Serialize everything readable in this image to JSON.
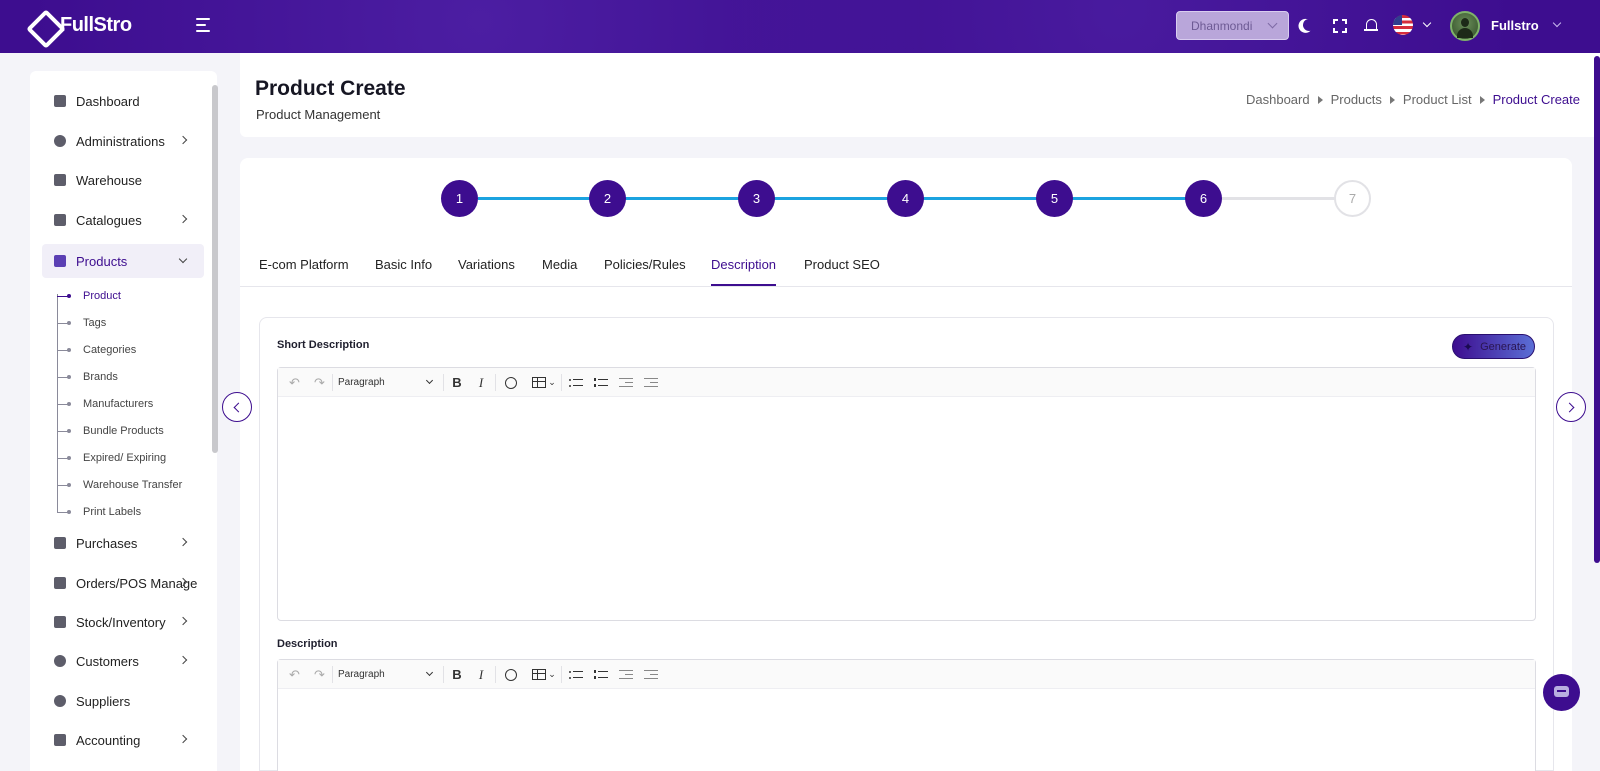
{
  "header": {
    "logo_text": "FullStro",
    "branch": "Dhanmondi",
    "username": "Fullstro"
  },
  "sidebar": {
    "items": [
      {
        "label": "Dashboard"
      },
      {
        "label": "Administrations"
      },
      {
        "label": "Warehouse"
      },
      {
        "label": "Catalogues"
      },
      {
        "label": "Products"
      },
      {
        "label": "Purchases"
      },
      {
        "label": "Orders/POS Manage"
      },
      {
        "label": "Stock/Inventory"
      },
      {
        "label": "Customers"
      },
      {
        "label": "Suppliers"
      },
      {
        "label": "Accounting"
      }
    ],
    "product_sub": [
      "Product",
      "Tags",
      "Categories",
      "Brands",
      "Manufacturers",
      "Bundle Products",
      "Expired/ Expiring",
      "Warehouse Transfer",
      "Print Labels"
    ]
  },
  "page": {
    "title": "Product Create",
    "subtitle": "Product Management",
    "breadcrumb": [
      "Dashboard",
      "Products",
      "Product List",
      "Product Create"
    ]
  },
  "steps": [
    "1",
    "2",
    "3",
    "4",
    "5",
    "6",
    "7"
  ],
  "tabs": [
    "E-com Platform",
    "Basic Info",
    "Variations",
    "Media",
    "Policies/Rules",
    "Description",
    "Product SEO"
  ],
  "form": {
    "short_description_label": "Short Description",
    "description_label": "Description",
    "generate_label": "Generate",
    "paragraph_label": "Paragraph"
  },
  "colors": {
    "primary": "#3d0d8f",
    "step_line_done": "#1ba3e0",
    "step_line_pending": "#e2e2e6"
  }
}
